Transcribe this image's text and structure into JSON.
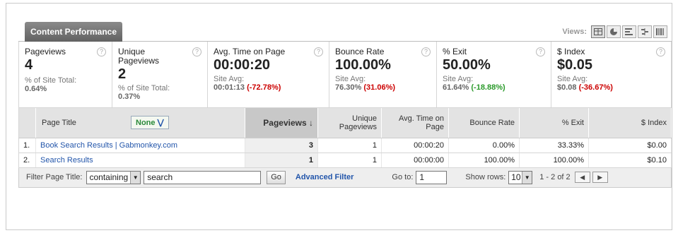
{
  "header": {
    "tab": "Content Performance",
    "views_label": "Views:"
  },
  "views": [
    "table-view",
    "pie-view",
    "bar-view",
    "comparison-view",
    "pivot-view"
  ],
  "metrics": [
    {
      "title": "Pageviews",
      "value": "4",
      "sub": "% of Site Total:",
      "avg": "0.64%",
      "delta": ""
    },
    {
      "title": "Unique Pageviews",
      "value": "2",
      "sub": "% of Site Total:",
      "avg": "0.37%",
      "delta": ""
    },
    {
      "title": "Avg. Time on Page",
      "value": "00:00:20",
      "sub": "Site Avg:",
      "avg": "00:01:13",
      "delta": "(-72.78%)"
    },
    {
      "title": "Bounce Rate",
      "value": "100.00%",
      "sub": "Site Avg:",
      "avg": "76.30%",
      "delta": "(31.06%)"
    },
    {
      "title": "% Exit",
      "value": "50.00%",
      "sub": "Site Avg:",
      "avg": "61.64%",
      "delta": "(-18.88%)"
    },
    {
      "title": "$ Index",
      "value": "$0.05",
      "sub": "Site Avg:",
      "avg": "$0.08",
      "delta": "(-36.67%)"
    }
  ],
  "table": {
    "headers": {
      "page_title": "Page Title",
      "secondary": "None",
      "pageviews": "Pageviews",
      "unique": "Unique Pageviews",
      "avg_time": "Avg. Time on Page",
      "bounce": "Bounce Rate",
      "exit": "% Exit",
      "index": "$ Index"
    },
    "rows": [
      {
        "num": "1.",
        "title": "Book Search Results | Gabmonkey.com",
        "pageviews": "3",
        "unique": "1",
        "avg_time": "00:00:20",
        "bounce": "0.00%",
        "exit": "33.33%",
        "index": "$0.00"
      },
      {
        "num": "2.",
        "title": "Search Results",
        "pageviews": "1",
        "unique": "1",
        "avg_time": "00:00:00",
        "bounce": "100.00%",
        "exit": "100.00%",
        "index": "$0.10"
      }
    ]
  },
  "filter": {
    "label": "Filter Page Title:",
    "mode": "containing",
    "query": "search",
    "go": "Go",
    "advanced": "Advanced Filter",
    "goto_label": "Go to:",
    "goto_value": "1",
    "rows_label": "Show rows:",
    "rows_value": "10",
    "range": "1 - 2 of 2"
  }
}
